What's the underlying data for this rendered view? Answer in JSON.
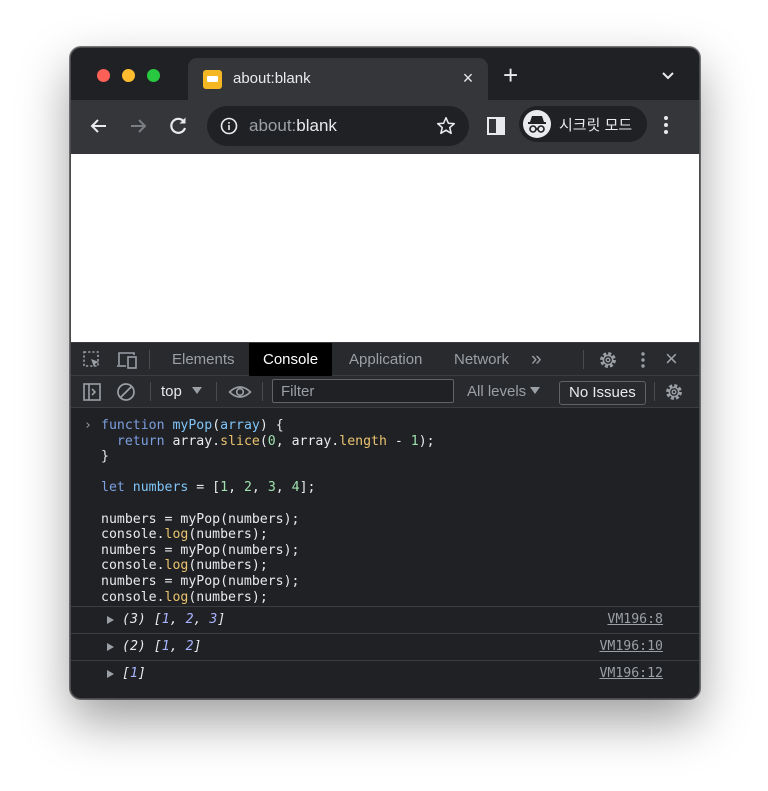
{
  "browser": {
    "tab": {
      "title": "about:blank",
      "close_glyph": "×"
    },
    "new_tab_glyph": "+",
    "url": {
      "scheme": "about:",
      "rest": "blank"
    },
    "profile_label": "시크릿 모드"
  },
  "devtools": {
    "tabs": [
      {
        "label": "Elements"
      },
      {
        "label": "Console"
      },
      {
        "label": "Application"
      },
      {
        "label": "Network"
      }
    ],
    "more_tabs_glyph": "»",
    "close_glyph": "×",
    "console_bar": {
      "context": "top",
      "filter_placeholder": "Filter",
      "levels": "All levels",
      "issues": "No Issues"
    },
    "prompt_glyph": "›",
    "code": {
      "l1_kw": "function",
      "l1_fn": "myPop",
      "l1_arg": "array",
      "l1_tail": ") {",
      "l2_kw": "return",
      "l2_a": "array.",
      "l2_slice": "slice",
      "l2_b": "(",
      "l2_zero": "0",
      "l2_c": ", array.",
      "l2_len": "length",
      "l2_d": " - ",
      "l2_one": "1",
      "l2_e": ");",
      "l3": "}",
      "l5_kw": "let",
      "l5_var": "numbers",
      "l5_eq": " = [",
      "n1": "1",
      "n2": "2",
      "n3": "3",
      "n4": "4",
      "l5_end": "];",
      "assign": "numbers = myPop(numbers);",
      "log_a": "console.",
      "log_fn": "log",
      "log_b": "(numbers);"
    },
    "logs": [
      {
        "count": "(3)",
        "open": "[",
        "items": [
          "1",
          "2",
          "3"
        ],
        "close": "]",
        "source": "VM196:8"
      },
      {
        "count": "(2)",
        "open": "[",
        "items": [
          "1",
          "2"
        ],
        "close": "]",
        "source": "VM196:10"
      },
      {
        "count": "",
        "open": "[",
        "items": [
          "1"
        ],
        "close": "]",
        "source": "VM196:12"
      }
    ]
  },
  "colors": {
    "traffic_red": "#fe5f57",
    "traffic_yellow": "#febc2e",
    "traffic_green": "#28c840",
    "favicon": "#f5b723",
    "keyword": "#7c9fe0",
    "property": "#e8c36f",
    "number": "#9ee0ae"
  }
}
